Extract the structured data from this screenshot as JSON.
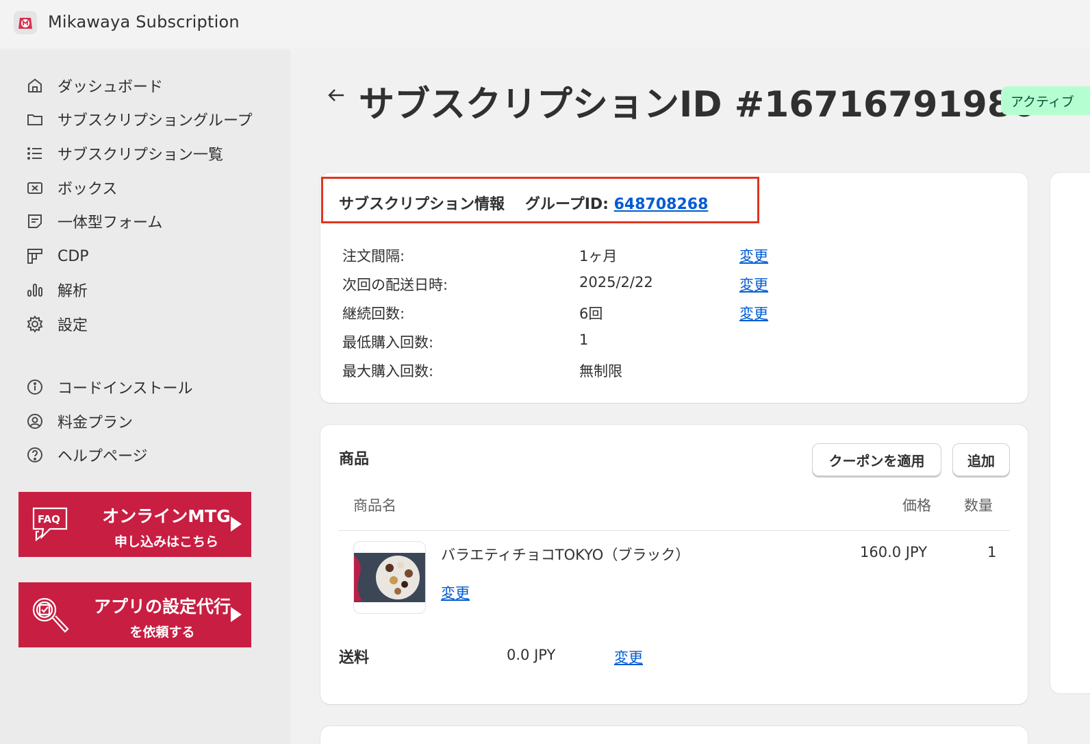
{
  "app": {
    "title": "Mikawaya Subscription"
  },
  "sidebar": {
    "items": [
      {
        "label": "ダッシュボード",
        "icon": "home-icon"
      },
      {
        "label": "サブスクリプショングループ",
        "icon": "folder-icon"
      },
      {
        "label": "サブスクリプション一覧",
        "icon": "list-icon"
      },
      {
        "label": "ボックス",
        "icon": "box-icon"
      },
      {
        "label": "一体型フォーム",
        "icon": "form-icon"
      },
      {
        "label": "CDP",
        "icon": "cdp-icon"
      },
      {
        "label": "解析",
        "icon": "chart-icon"
      },
      {
        "label": "設定",
        "icon": "gear-icon"
      }
    ],
    "secondary": [
      {
        "label": "コードインストール",
        "icon": "info-icon"
      },
      {
        "label": "料金プラン",
        "icon": "user-circle-icon"
      },
      {
        "label": "ヘルプページ",
        "icon": "help-icon"
      }
    ],
    "banners": [
      {
        "badge": "FAQ",
        "line1": "オンラインMTG",
        "line2": "申し込みはこちら"
      },
      {
        "line1": "アプリの設定代行",
        "line2": "を依頼する"
      }
    ]
  },
  "header": {
    "title": "サブスクリプションID #16716791980",
    "status": "アクティブ"
  },
  "info": {
    "title": "サブスクリプション情報",
    "group_label": "グループID:",
    "group_id": "648708268",
    "change_label": "変更",
    "rows": [
      {
        "label": "注文間隔:",
        "value": "1ヶ月",
        "changeable": true
      },
      {
        "label": "次回の配送日時:",
        "value": "2025/2/22",
        "changeable": true
      },
      {
        "label": "継続回数:",
        "value": "6回",
        "changeable": true
      },
      {
        "label": "最低購入回数:",
        "value": "1",
        "changeable": false
      },
      {
        "label": "最大購入回数:",
        "value": "無制限",
        "changeable": false
      }
    ]
  },
  "products": {
    "title": "商品",
    "coupon_button": "クーポンを適用",
    "add_button": "追加",
    "columns": {
      "name": "商品名",
      "price": "価格",
      "quantity": "数量"
    },
    "items": [
      {
        "name": "バラエティチョコTOKYO（ブラック）",
        "price": "160.0 JPY",
        "quantity": "1",
        "change_label": "変更"
      }
    ],
    "shipping": {
      "label": "送料",
      "value": "0.0 JPY",
      "change_label": "変更"
    }
  },
  "colors": {
    "accent": "#c81e42",
    "link": "#005bd3",
    "status_bg": "#b4fed2",
    "highlight": "#e0341f"
  }
}
